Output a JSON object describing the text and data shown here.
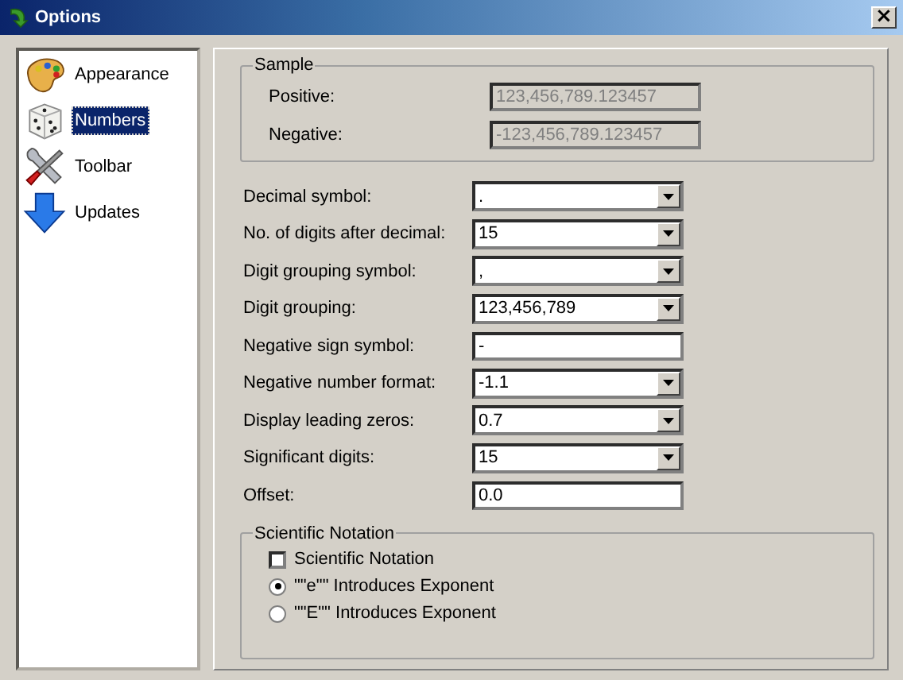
{
  "window": {
    "title": "Options",
    "close": "×"
  },
  "sidebar": {
    "items": [
      {
        "label": "Appearance",
        "kind": "palette",
        "selected": false
      },
      {
        "label": "Numbers",
        "kind": "dice",
        "selected": true
      },
      {
        "label": "Toolbar",
        "kind": "tools",
        "selected": false
      },
      {
        "label": "Updates",
        "kind": "arrow",
        "selected": false
      }
    ]
  },
  "sample": {
    "title": "Sample",
    "fields": [
      {
        "label": "Positive:",
        "value": "123,456,789.123457",
        "disabled": true
      },
      {
        "label": "Negative:",
        "value": "-123,456,789.123457",
        "disabled": true
      }
    ]
  },
  "settings": [
    {
      "label": "Decimal symbol:",
      "kind": "dropdown",
      "value": "."
    },
    {
      "label": "No. of digits after decimal:",
      "kind": "dropdown",
      "value": "15"
    },
    {
      "label": "Digit grouping symbol:",
      "kind": "dropdown",
      "value": ","
    },
    {
      "label": "Digit grouping:",
      "kind": "dropdown",
      "value": "123,456,789"
    },
    {
      "label": "Negative sign symbol:",
      "kind": "text",
      "value": "-"
    },
    {
      "label": "Negative number format:",
      "kind": "dropdown",
      "value": "-1.1"
    },
    {
      "label": "Display leading zeros:",
      "kind": "dropdown",
      "value": "0.7"
    },
    {
      "label": "Significant digits:",
      "kind": "dropdown",
      "value": "15"
    },
    {
      "label": "Offset:",
      "kind": "text",
      "value": "0.0"
    }
  ],
  "scientific": {
    "title": "Scientific Notation",
    "options": [
      {
        "kind": "checkbox",
        "label": "Scientific Notation",
        "checked": false
      },
      {
        "kind": "radio",
        "label": "\"\"e\"\" Introduces Exponent",
        "selected": true
      },
      {
        "kind": "radio",
        "label": "\"\"E\"\" Introduces Exponent",
        "selected": false
      }
    ]
  }
}
